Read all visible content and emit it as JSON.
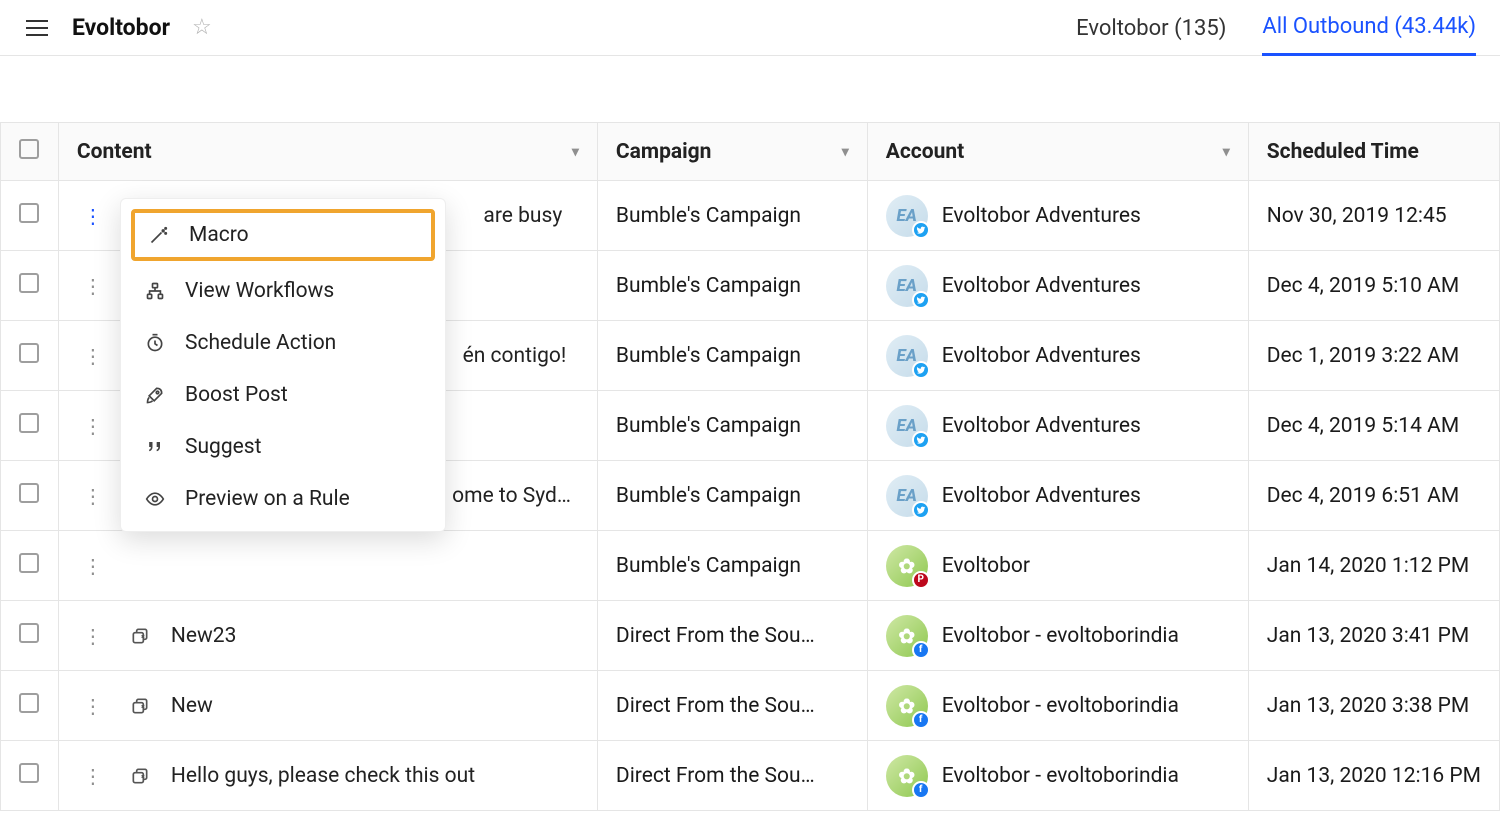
{
  "header": {
    "title": "Evoltobor",
    "tab_current": "Evoltobor (135)",
    "tab_all": "All Outbound (43.44k)"
  },
  "columns": {
    "content": "Content",
    "campaign": "Campaign",
    "account": "Account",
    "scheduled": "Scheduled Time"
  },
  "menu": {
    "macro": "Macro",
    "view_workflows": "View Workflows",
    "schedule_action": "Schedule Action",
    "boost_post": "Boost Post",
    "suggest": "Suggest",
    "preview_rule": "Preview on a Rule"
  },
  "rows": [
    {
      "content": "are busy",
      "campaign": "Bumble's Campaign",
      "account": "Evoltobor Adventures",
      "avatar": "ea",
      "badge": "tw",
      "scheduled": "Nov 30, 2019 12:45"
    },
    {
      "content": "",
      "campaign": "Bumble's Campaign",
      "account": "Evoltobor Adventures",
      "avatar": "ea",
      "badge": "tw",
      "scheduled": "Dec 4, 2019 5:10 AM"
    },
    {
      "content": "én contigo!",
      "campaign": "Bumble's Campaign",
      "account": "Evoltobor Adventures",
      "avatar": "ea",
      "badge": "tw",
      "scheduled": "Dec 1, 2019 3:22 AM"
    },
    {
      "content": "",
      "campaign": "Bumble's Campaign",
      "account": "Evoltobor Adventures",
      "avatar": "ea",
      "badge": "tw",
      "scheduled": "Dec 4, 2019 5:14 AM"
    },
    {
      "content": "ome to Syd…",
      "campaign": "Bumble's Campaign",
      "account": "Evoltobor Adventures",
      "avatar": "ea",
      "badge": "tw",
      "scheduled": "Dec 4, 2019 6:51 AM"
    },
    {
      "content": "",
      "campaign": "Bumble's Campaign",
      "account": "Evoltobor",
      "avatar": "gear",
      "badge": "pin",
      "scheduled": "Jan 14, 2020 1:12 PM"
    },
    {
      "content": "New23",
      "campaign": "Direct From the Sou…",
      "account": "Evoltobor - evoltoborindia",
      "avatar": "gear",
      "badge": "fb",
      "scheduled": "Jan 13, 2020 3:41 PM",
      "icon": "dup"
    },
    {
      "content": "New",
      "campaign": "Direct From the Sou…",
      "account": "Evoltobor - evoltoborindia",
      "avatar": "gear",
      "badge": "fb",
      "scheduled": "Jan 13, 2020 3:38 PM",
      "icon": "dup"
    },
    {
      "content": "Hello guys, please check this out",
      "campaign": "Direct From the Sou…",
      "account": "Evoltobor - evoltoborindia",
      "avatar": "gear",
      "badge": "fb",
      "scheduled": "Jan 13, 2020 12:16 PM",
      "icon": "dup"
    }
  ]
}
